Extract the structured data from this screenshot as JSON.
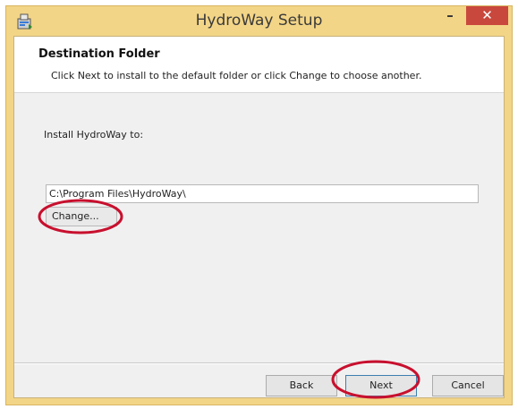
{
  "window": {
    "title": "HydroWay Setup",
    "icon": "installer-icon",
    "controls": {
      "minimize_icon": "minimize-icon",
      "maximize_icon": "maximize-icon",
      "close_icon": "close-icon",
      "close_color": "#c9483d"
    },
    "frame_color": "#f3d587"
  },
  "banner": {
    "title": "Destination Folder",
    "description": "Click Next to install to the default folder or click Change to choose another."
  },
  "main": {
    "install_label": "Install HydroWay to:",
    "path_value": "C:\\Program Files\\HydroWay\\",
    "change_label": "Change..."
  },
  "footer": {
    "back_label": "Back",
    "next_label": "Next",
    "cancel_label": "Cancel"
  },
  "annotations": {
    "color": "#c8102e",
    "highlighted": [
      "change-button",
      "next-button"
    ]
  }
}
